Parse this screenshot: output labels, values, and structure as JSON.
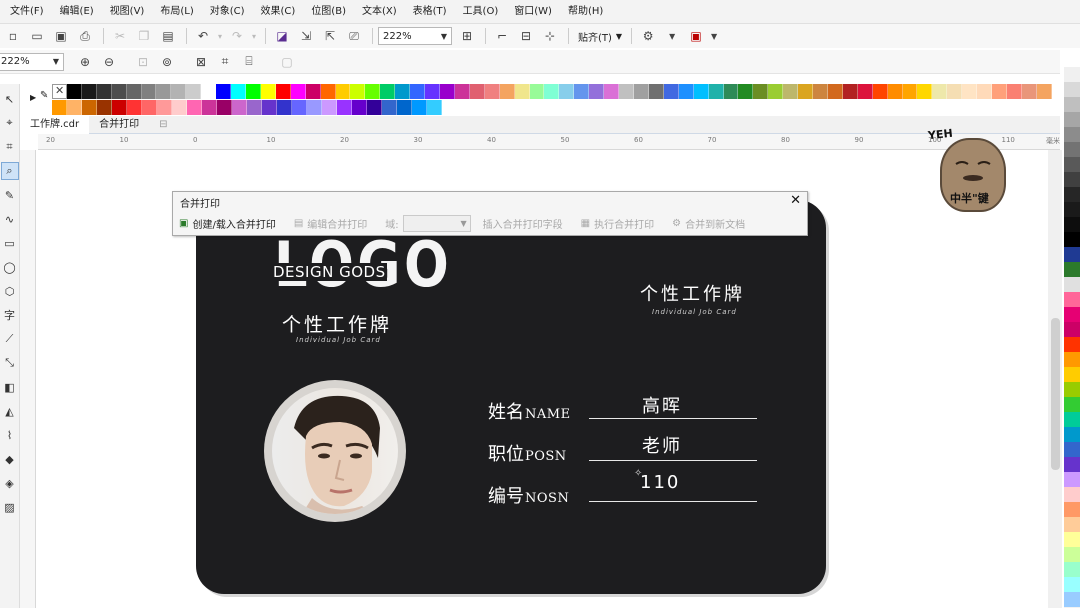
{
  "menu": [
    "文件(F)",
    "编辑(E)",
    "视图(V)",
    "布局(L)",
    "对象(C)",
    "效果(C)",
    "位图(B)",
    "文本(X)",
    "表格(T)",
    "工具(O)",
    "窗口(W)",
    "帮助(H)"
  ],
  "toolbar": {
    "zoom_value": "222%",
    "snap_label": "贴齐(T)"
  },
  "toolbar2": {
    "zoom_value": "222%"
  },
  "doc_tabs": [
    "工作牌.cdr",
    "合并打印"
  ],
  "ruler": {
    "ticks": [
      "20",
      "10",
      "0",
      "10",
      "20",
      "30",
      "40",
      "50",
      "60",
      "70",
      "80",
      "90",
      "100",
      "110"
    ],
    "unit": "毫米"
  },
  "palette": {
    "row1": [
      "#000000",
      "#1a1a1a",
      "#333333",
      "#4d4d4d",
      "#666666",
      "#808080",
      "#999999",
      "#b3b3b3",
      "#cccccc",
      "#ffffff",
      "#0000ff",
      "#00ffff",
      "#00ff00",
      "#ffff00",
      "#ff0000",
      "#ff00ff",
      "#cc0066",
      "#ff6600",
      "#ffcc00",
      "#ccff00",
      "#66ff00",
      "#00cc66",
      "#0099cc",
      "#3366ff",
      "#6633ff",
      "#9900cc",
      "#cc3399",
      "#e06070",
      "#f08080",
      "#f4a460",
      "#f0e68c",
      "#98fb98",
      "#7fffd4",
      "#87ceeb",
      "#6495ed",
      "#9370db",
      "#da70d6",
      "#c0c0c0",
      "#a0a0a0",
      "#707070",
      "#4169e1",
      "#1e90ff",
      "#00bfff",
      "#20b2aa",
      "#2e8b57",
      "#228b22",
      "#6b8e23",
      "#9acd32",
      "#bdb76b",
      "#daa520",
      "#cd853f",
      "#d2691e",
      "#b22222",
      "#dc143c",
      "#ff4500",
      "#ff8c00",
      "#ffa500",
      "#ffd700",
      "#eee8aa",
      "#f5deb3",
      "#ffe4c4",
      "#ffdab9",
      "#ffa07a",
      "#fa8072",
      "#e9967a",
      "#f4a460",
      "#d2b48c"
    ],
    "row2": [
      "#ff9900",
      "#ffb366",
      "#cc6600",
      "#993300",
      "#cc0000",
      "#ff3333",
      "#ff6666",
      "#ff9999",
      "#ffcccc",
      "#ff66b2",
      "#cc3399",
      "#990066",
      "#cc66cc",
      "#9966cc",
      "#6633cc",
      "#3333cc",
      "#6666ff",
      "#9999ff",
      "#cc99ff",
      "#9933ff",
      "#6600cc",
      "#330099",
      "#3366cc",
      "#0066cc",
      "#0099ff",
      "#33ccff"
    ],
    "right": [
      "#ffffff",
      "#f0f0f0",
      "#d9d9d9",
      "#bfbfbf",
      "#a6a6a6",
      "#8c8c8c",
      "#737373",
      "#595959",
      "#404040",
      "#262626",
      "#1a1a1a",
      "#0d0d0d",
      "#000000",
      "#1f3a93",
      "#2c7a2c",
      "#e0e0e0",
      "#ff6699",
      "#e60073",
      "#cc0066",
      "#ff3300",
      "#ff9900",
      "#ffcc00",
      "#99cc00",
      "#33cc33",
      "#00cc99",
      "#0099cc",
      "#3366cc",
      "#6633cc",
      "#cc99ff",
      "#ffcccc",
      "#ff9966",
      "#ffcc99",
      "#ffff99",
      "#ccff99",
      "#99ffcc",
      "#99ffff",
      "#99ccff"
    ]
  },
  "card": {
    "logo": "LOGO",
    "logo_overlay": "DESIGN GODS",
    "logo_sub": "个性工作牌",
    "logo_en": "Individual Job Card",
    "right_title": "个性工作牌",
    "right_en": "Individual Job Card",
    "fields": [
      {
        "label_cn": "姓名",
        "label_en": "NAME",
        "value": "高晖"
      },
      {
        "label_cn": "职位",
        "label_en": "POSN",
        "value": "老师"
      },
      {
        "label_cn": "编号",
        "label_en": "NOSN",
        "value": "110"
      }
    ]
  },
  "dialog": {
    "title": "合并打印",
    "create_btn": "创建/载入合并打印",
    "edit_btn": "编辑合并打印",
    "field_label": "域:",
    "insert_btn": "插入合并打印字段",
    "run_btn": "执行合并打印",
    "reset_btn": "合并到新文档"
  },
  "sticker": {
    "top": "YEH",
    "bottom": "中半\"键"
  }
}
